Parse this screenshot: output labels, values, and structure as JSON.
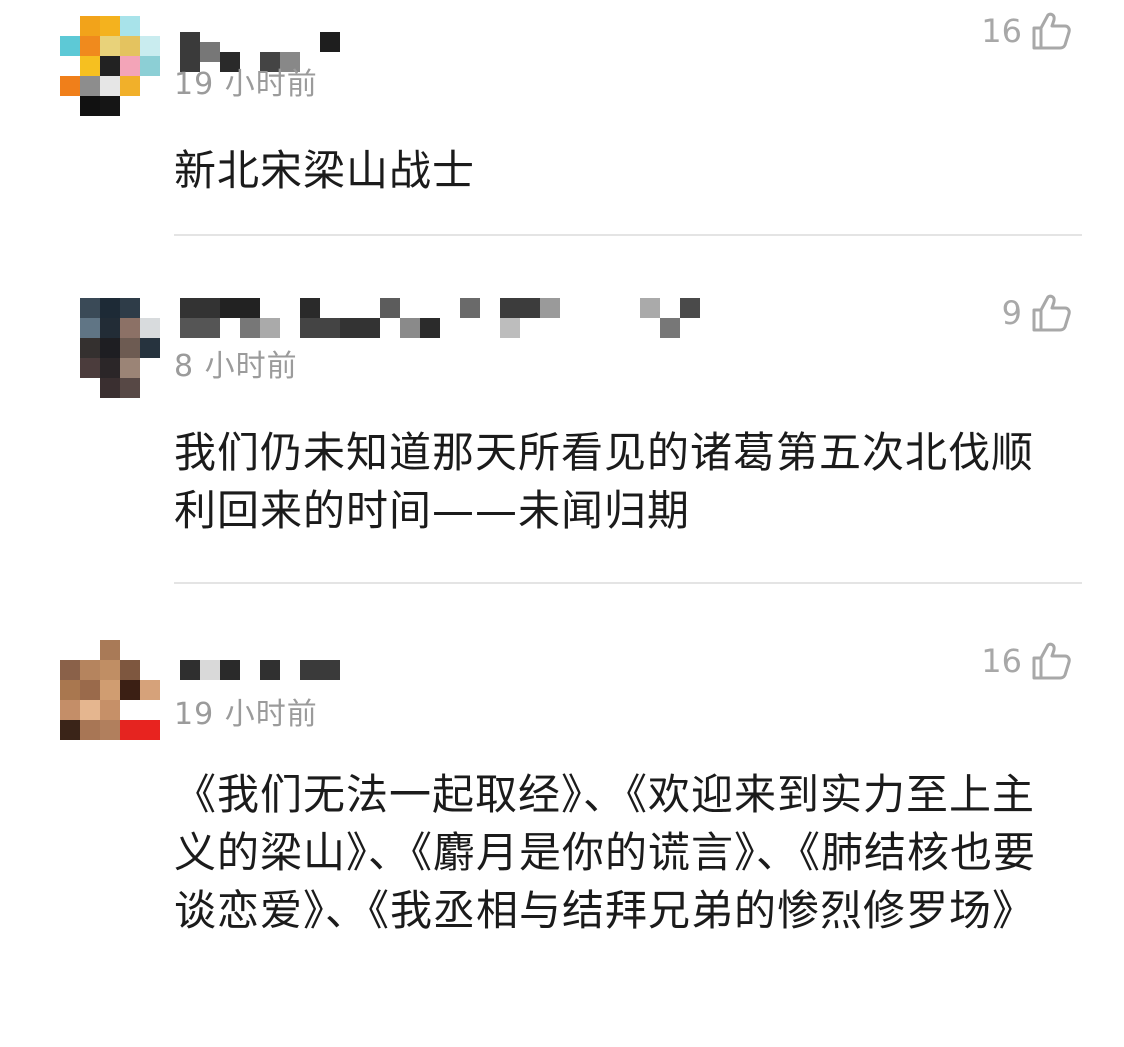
{
  "colors": {
    "text": "#1b1b1b",
    "meta": "#9b9b9b",
    "divider": "#e4e4e4",
    "background": "#ffffff"
  },
  "comments": [
    {
      "time": "19 小时前",
      "likes": "16",
      "text": "新北宋梁山战士",
      "avatar_icon": "user-avatar-pixelated",
      "like_icon": "thumbs-up-icon"
    },
    {
      "time": "8 小时前",
      "likes": "9",
      "text": "我们仍未知道那天所看见的诸葛第五次北伐顺利回来的时间——未闻归期",
      "avatar_icon": "user-avatar-pixelated",
      "like_icon": "thumbs-up-icon"
    },
    {
      "time": "19 小时前",
      "likes": "16",
      "text": "《我们无法一起取经》、《欢迎来到实力至上主义的梁山》、《麝月是你的谎言》、《肺结核也要谈恋爱》、《我丞相与结拜兄弟的惨烈修罗场》",
      "avatar_icon": "user-avatar-pixelated",
      "like_icon": "thumbs-up-icon"
    }
  ]
}
